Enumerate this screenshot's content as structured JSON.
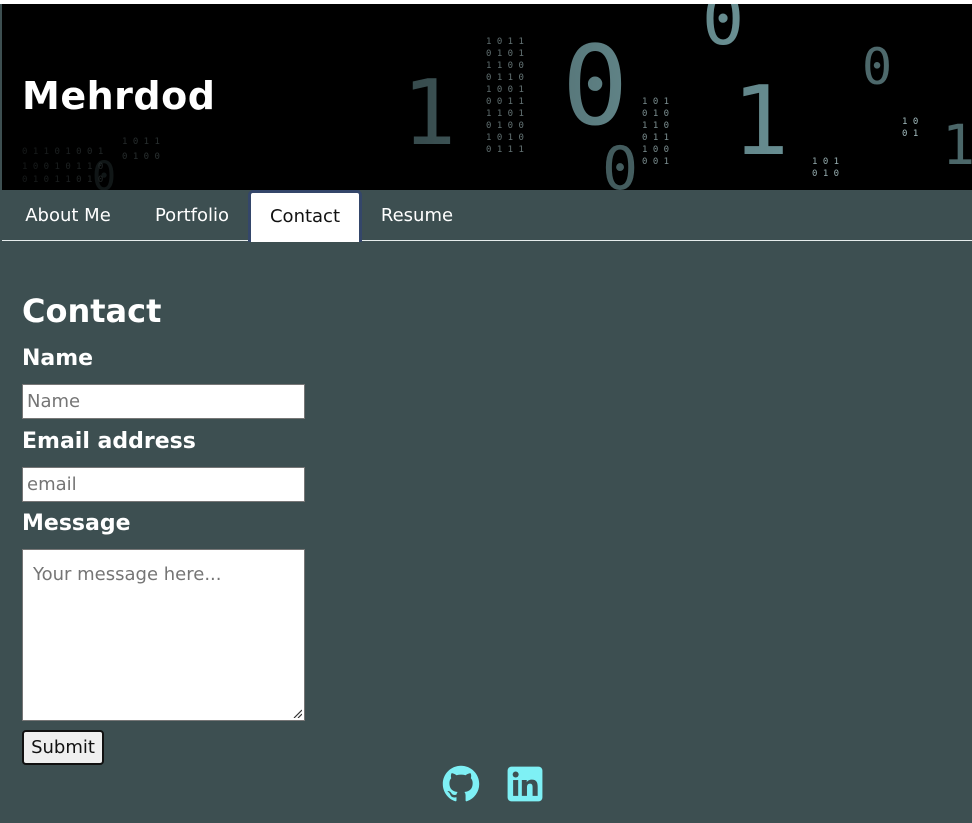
{
  "header": {
    "title": "Mehrdod"
  },
  "nav": {
    "items": [
      {
        "label": "About Me"
      },
      {
        "label": "Portfolio"
      },
      {
        "label": "Contact"
      },
      {
        "label": "Resume"
      }
    ],
    "active": "Contact"
  },
  "contact": {
    "heading": "Contact",
    "name_label": "Name",
    "name_placeholder": "Name",
    "email_label": "Email address",
    "email_placeholder": "email",
    "message_label": "Message",
    "message_placeholder": "Your message here...",
    "submit_label": "Submit"
  },
  "footer": {
    "icons": [
      "github-icon",
      "linkedin-icon"
    ]
  },
  "colors": {
    "background": "#3d4f51",
    "active_tab_border": "#34466a",
    "icon_accent": "#7ef0f5"
  }
}
